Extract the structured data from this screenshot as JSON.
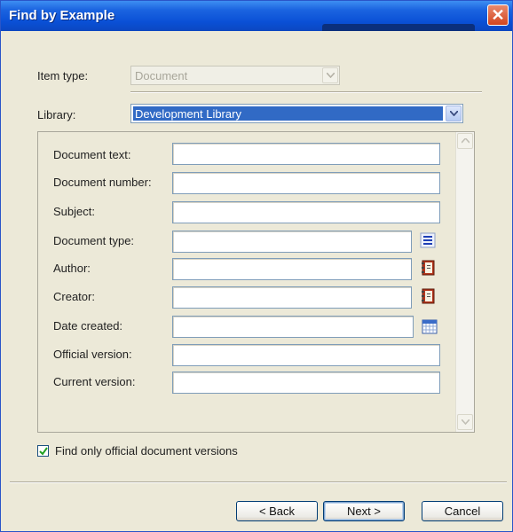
{
  "window": {
    "title": "Find by Example"
  },
  "item_type": {
    "label": "Item type:",
    "value": "Document"
  },
  "library": {
    "label": "Library:",
    "value": "Development Library"
  },
  "fields": [
    {
      "label": "Document text:",
      "icon": ""
    },
    {
      "label": "Document number:",
      "icon": ""
    },
    {
      "label": "Subject:",
      "icon": ""
    },
    {
      "label": "Document type:",
      "icon": "list-icon"
    },
    {
      "label": "Author:",
      "icon": "address-book-icon"
    },
    {
      "label": "Creator:",
      "icon": "address-book-icon"
    },
    {
      "label": "Date created:",
      "icon": "calendar-icon"
    },
    {
      "label": "Official version:",
      "icon": ""
    },
    {
      "label": "Current version:",
      "icon": ""
    }
  ],
  "official_only": {
    "label": "Find only official document versions",
    "checked": true
  },
  "buttons": {
    "back": "< Back",
    "next": "Next >",
    "cancel": "Cancel"
  },
  "colors": {
    "titlebar": "#0a50d6",
    "selection": "#316ac5",
    "dialog_bg": "#ece9d8"
  }
}
